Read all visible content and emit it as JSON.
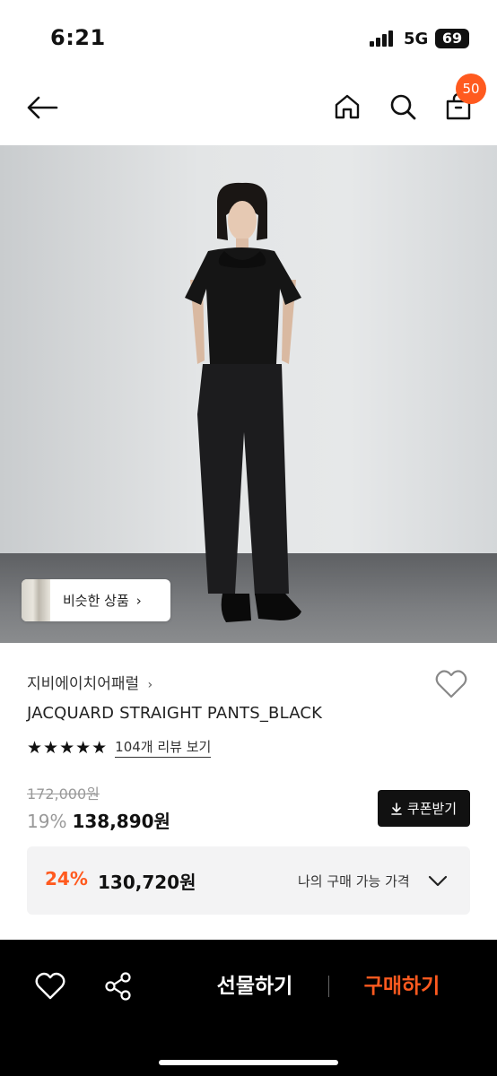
{
  "status_bar": {
    "time": "6:21",
    "network": "5G",
    "battery": "69"
  },
  "top_nav": {
    "back_icon": "arrow-left-icon",
    "home_icon": "home-icon",
    "search_icon": "search-icon",
    "bag_icon": "shopping-bag-icon",
    "cart_count": "50"
  },
  "product_image": {
    "similar_products_label": "비슷한 상품",
    "similar_chevron": "›"
  },
  "product": {
    "brand": "지비에이치어패럴",
    "brand_chevron": "›",
    "name": "JACQUARD STRAIGHT PANTS_BLACK",
    "stars": "★★★★★",
    "review_link": "104개 리뷰 보기",
    "original_price": "172,000원",
    "discount_rate": "19%",
    "price": "138,890원",
    "coupon_label": "쿠폰받기",
    "coupon_icon": "download-icon",
    "wish_icon": "heart-outline-icon"
  },
  "my_price": {
    "discount_rate": "24%",
    "price": "130,720원",
    "label": "나의 구매 가능 가격",
    "expand_icon": "chevron-down-icon"
  },
  "bottom_bar": {
    "heart_icon": "heart-outline-icon",
    "share_icon": "share-icon",
    "gift_label": "선물하기",
    "buy_label": "구매하기"
  },
  "colors": {
    "accent": "#ff5a1f",
    "bottom_bar_bg": "#000000",
    "coupon_bg": "#111111",
    "my_price_box_bg": "#f3f3f4"
  }
}
